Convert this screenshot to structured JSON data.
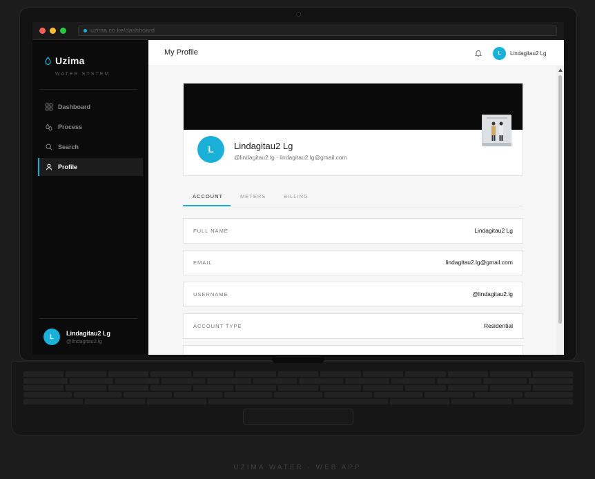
{
  "browser": {
    "url": "uzima.co.ke/dashboard"
  },
  "sidebar": {
    "brand": "Uzima",
    "brand_sub": "WATER SYSTEM",
    "items": [
      {
        "label": "Dashboard",
        "icon": "grid-icon"
      },
      {
        "label": "Process",
        "icon": "drops-icon"
      },
      {
        "label": "Search",
        "icon": "search-icon"
      },
      {
        "label": "Profile",
        "icon": "user-icon",
        "active": true
      }
    ],
    "user": {
      "initial": "L",
      "name": "Lindagitau2 Lg",
      "handle": "@lindagitau2.lg"
    }
  },
  "topbar": {
    "title": "My Profile",
    "user_initial": "L",
    "user_name": "Lindagitau2 Lg"
  },
  "profile": {
    "initial": "L",
    "name": "Lindagitau2 Lg",
    "subline": "@lindagitau2.lg · lindagitau2.lg@gmail.com"
  },
  "tabs": [
    {
      "label": "ACCOUNT",
      "active": true
    },
    {
      "label": "METERS"
    },
    {
      "label": "BILLING"
    }
  ],
  "fields": [
    {
      "label": "FULL NAME",
      "value": "Lindagitau2 Lg"
    },
    {
      "label": "EMAIL",
      "value": "lindagitau2.lg@gmail.com"
    },
    {
      "label": "USERNAME",
      "value": "@lindagitau2.lg"
    },
    {
      "label": "ACCOUNT TYPE",
      "value": "Residential"
    }
  ],
  "caption": "UZIMA WATER  ·  WEB APP",
  "colors": {
    "accent": "#1ab0d8",
    "sidebar_bg": "#0b0b0b",
    "content_bg": "#f6f6f6"
  }
}
